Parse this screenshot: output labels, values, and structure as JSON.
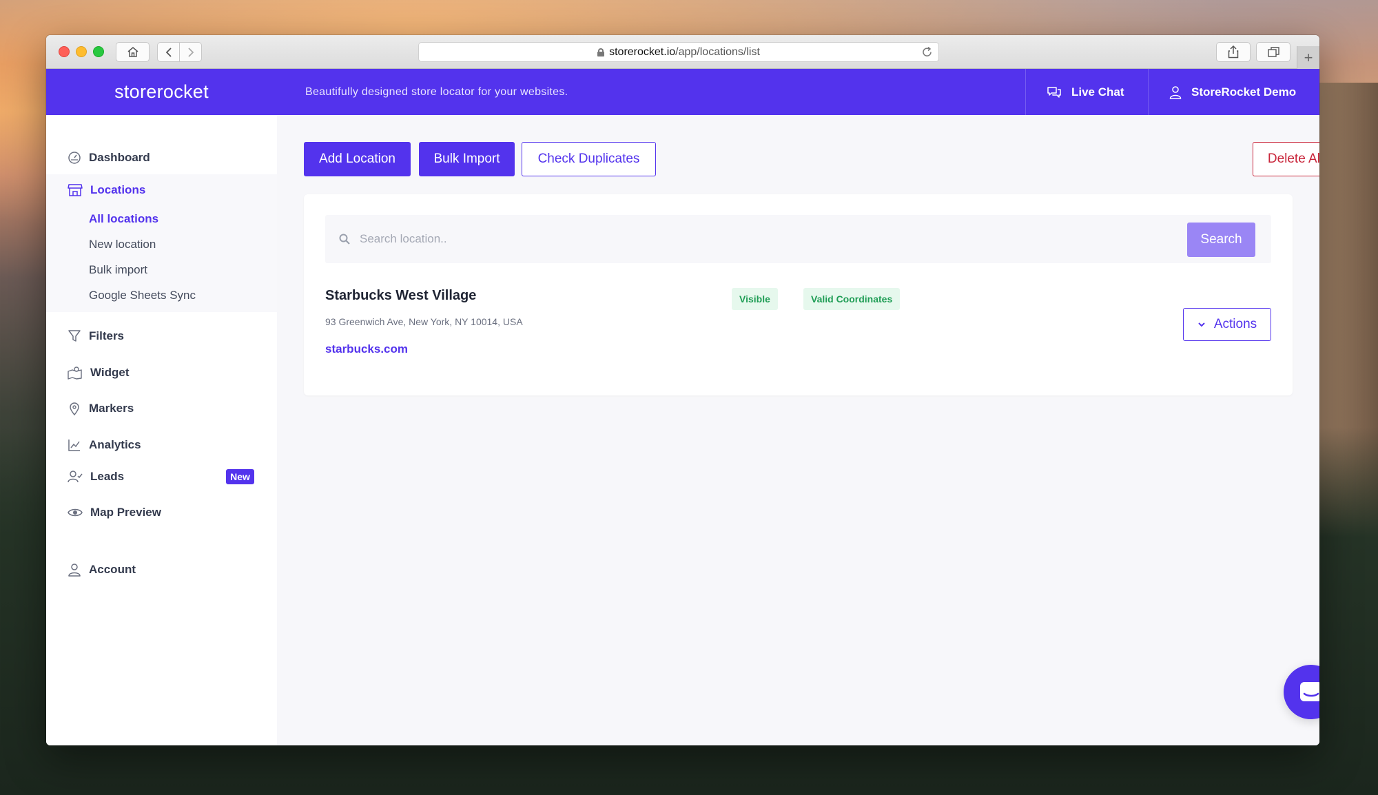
{
  "browser": {
    "url_host": "storerocket.io",
    "url_path": "/app/locations/list"
  },
  "header": {
    "logo": "storerocket",
    "tagline": "Beautifully designed store locator for your websites.",
    "live_chat": "Live Chat",
    "user": "StoreRocket Demo"
  },
  "sidebar": {
    "dashboard": "Dashboard",
    "locations": "Locations",
    "locations_sub": [
      "All locations",
      "New location",
      "Bulk import",
      "Google Sheets Sync"
    ],
    "filters": "Filters",
    "widget": "Widget",
    "markers": "Markers",
    "analytics": "Analytics",
    "leads": "Leads",
    "leads_badge": "New",
    "map_preview": "Map Preview",
    "account": "Account"
  },
  "toolbar": {
    "add_location": "Add Location",
    "bulk_import": "Bulk Import",
    "check_duplicates": "Check Duplicates",
    "delete_all": "Delete All"
  },
  "search": {
    "placeholder": "Search location..",
    "button": "Search"
  },
  "locations": [
    {
      "name": "Starbucks West Village",
      "address": "93 Greenwich Ave, New York, NY 10014, USA",
      "website": "starbucks.com",
      "tags": [
        "Visible",
        "Valid Coordinates"
      ],
      "actions_label": "Actions"
    }
  ],
  "colors": {
    "brand": "#5333ed",
    "danger": "#c9253a",
    "success": "#1f9d55"
  }
}
